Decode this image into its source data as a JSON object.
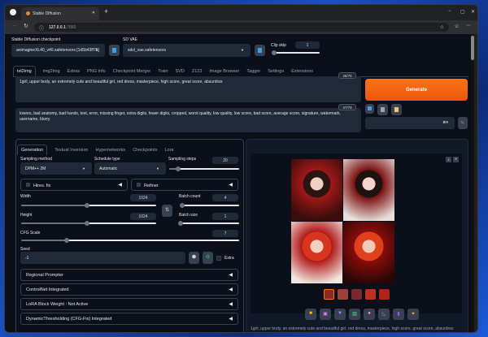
{
  "browser": {
    "tab_title": "Stable Diffusion",
    "url_host": "127.0.0.1",
    "url_port": ":7860",
    "new_tab": "+",
    "minimize": "−",
    "maximize": "▢",
    "close": "✕"
  },
  "top": {
    "checkpoint_label": "Stable Diffusion checkpoint",
    "checkpoint_value": "animagineXL40_v40.safetensors [1d5b43ff75]",
    "vae_label": "SD VAE",
    "vae_value": "sdxl_vae.safetensors",
    "clip_label": "Clip skip",
    "clip_value": "1",
    "clip_fraction": 0
  },
  "main_tabs": [
    "txt2img",
    "img2img",
    "Extras",
    "PNG Info",
    "Checkpoint Merger",
    "Train",
    "SVD",
    "Z123",
    "Image Browser",
    "Tagger",
    "Settings",
    "Extensions"
  ],
  "prompt": {
    "text": "1girl, upper body, an extremely cute and beautiful girl, red dress, masterpiece, high score, great score, absurdres",
    "count": "26/75"
  },
  "negative": {
    "text": "lowres, bad anatomy, bad hands, text, error, missing finger, extra digits, fewer digits, cropped, worst quality, low quality, low score, bad score, average score, signature, watermark, username, blurry",
    "count": "47/75"
  },
  "generate": "Generate",
  "sub_tabs": [
    "Generation",
    "Textual Inversion",
    "Hypernetworks",
    "Checkpoints",
    "Lora"
  ],
  "gen": {
    "sampling_method_label": "Sampling method",
    "sampling_method": "DPM++ 2M",
    "schedule_label": "Schedule type",
    "schedule": "Automatic",
    "steps_label": "Sampling steps",
    "steps": "20",
    "steps_fraction": 0.13,
    "hires": "Hires. fix",
    "refiner": "Refiner",
    "width_label": "Width",
    "width": "1024",
    "width_fraction": 0.49,
    "height_label": "Height",
    "height": "1024",
    "height_fraction": 0.49,
    "batch_count_label": "Batch count",
    "batch_count": "4",
    "batch_count_fraction": 0.03,
    "batch_size_label": "Batch size",
    "batch_size": "1",
    "batch_size_fraction": 0,
    "cfg_label": "CFG Scale",
    "cfg": "7",
    "cfg_fraction": 0.21,
    "seed_label": "Seed",
    "seed": "-1",
    "extra": "Extra"
  },
  "accordions": [
    "Regional Prompter",
    "ControlNet Integrated",
    "LoRA Block Weight : Not Active",
    "DynamicThresholding (CFG-Fix) Integrated"
  ],
  "output": {
    "caption": "1girl, upper body, an extremely cute and beautiful girl, red dress, masterpiece, high score, great score, absurdres"
  },
  "colors": {
    "accent": "#f97316",
    "bg": "#0b0f19",
    "panel": "#1f2937"
  }
}
